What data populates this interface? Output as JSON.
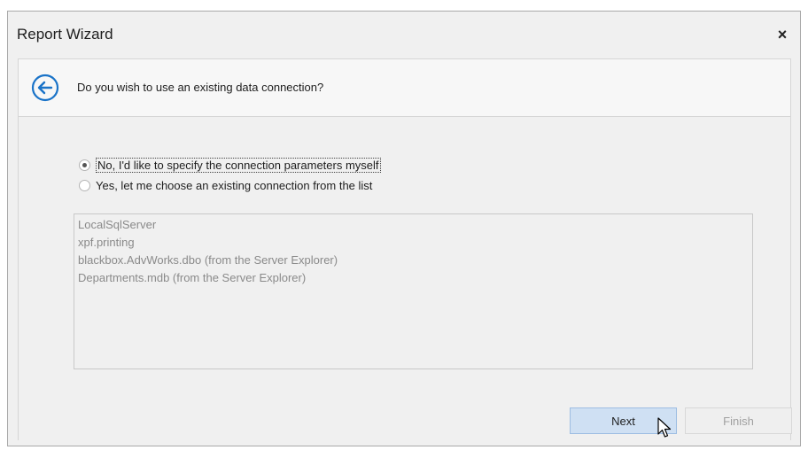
{
  "window": {
    "title": "Report Wizard",
    "close_label": "×"
  },
  "header": {
    "question": "Do you wish to use an existing data connection?",
    "back_icon": "back-arrow-circle-icon",
    "accent_color": "#1a73c8"
  },
  "options": {
    "specify": {
      "label": "No, I'd like to specify the connection parameters myself",
      "checked": true
    },
    "choose": {
      "label": "Yes, let me choose an existing connection from the list",
      "checked": false
    }
  },
  "connections": [
    "LocalSqlServer",
    "xpf.printing",
    "blackbox.AdvWorks.dbo (from the Server Explorer)",
    "Departments.mdb (from the Server Explorer)"
  ],
  "buttons": {
    "next_label": "Next",
    "finish_label": "Finish",
    "finish_enabled": false
  }
}
